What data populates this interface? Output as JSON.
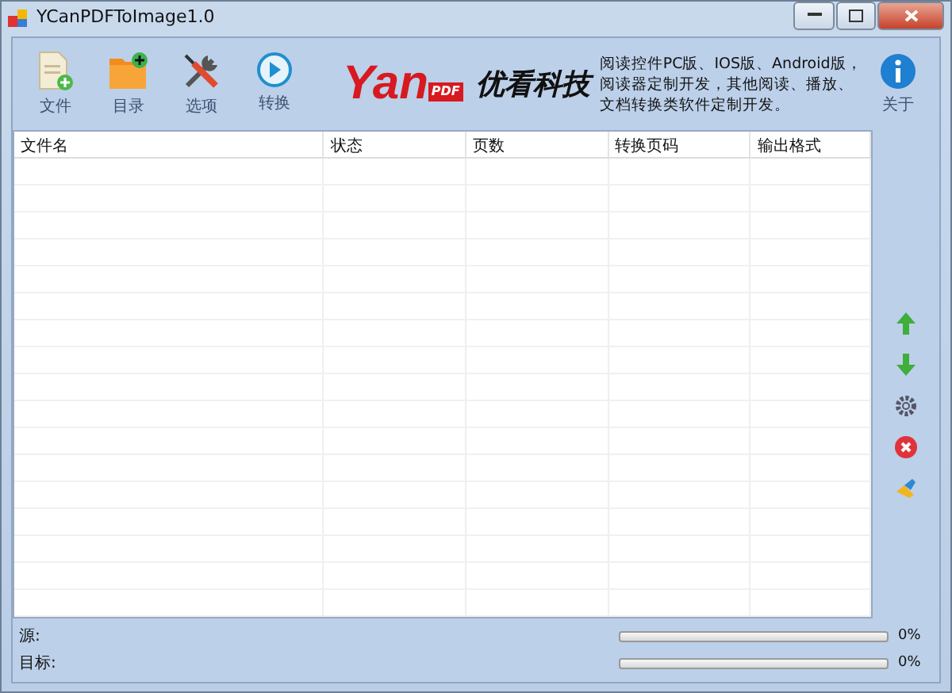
{
  "window": {
    "title": "YCanPDFToImage1.0"
  },
  "toolbar": [
    {
      "kind": "file",
      "label": "文件"
    },
    {
      "kind": "folder",
      "label": "目录"
    },
    {
      "kind": "tools",
      "label": "选项"
    },
    {
      "kind": "play",
      "label": "转换"
    }
  ],
  "logo": {
    "brand": "Yan",
    "badge": "PDF",
    "company": "优看科技"
  },
  "promo": "阅读控件PC版、IOS版、Android版，阅读器定制开发，其他阅读、播放、文档转换类软件定制开发。",
  "about": {
    "label": "关于"
  },
  "table": {
    "columns": [
      "文件名",
      "状态",
      "页数",
      "转换页码",
      "输出格式"
    ]
  },
  "side_tools": [
    {
      "kind": "up"
    },
    {
      "kind": "down"
    },
    {
      "kind": "gear"
    },
    {
      "kind": "delete"
    },
    {
      "kind": "clear"
    }
  ],
  "progress": [
    {
      "label": "源:",
      "level": 0,
      "reading": "0%"
    },
    {
      "label": "目标:",
      "level": 0,
      "reading": "0%"
    }
  ]
}
